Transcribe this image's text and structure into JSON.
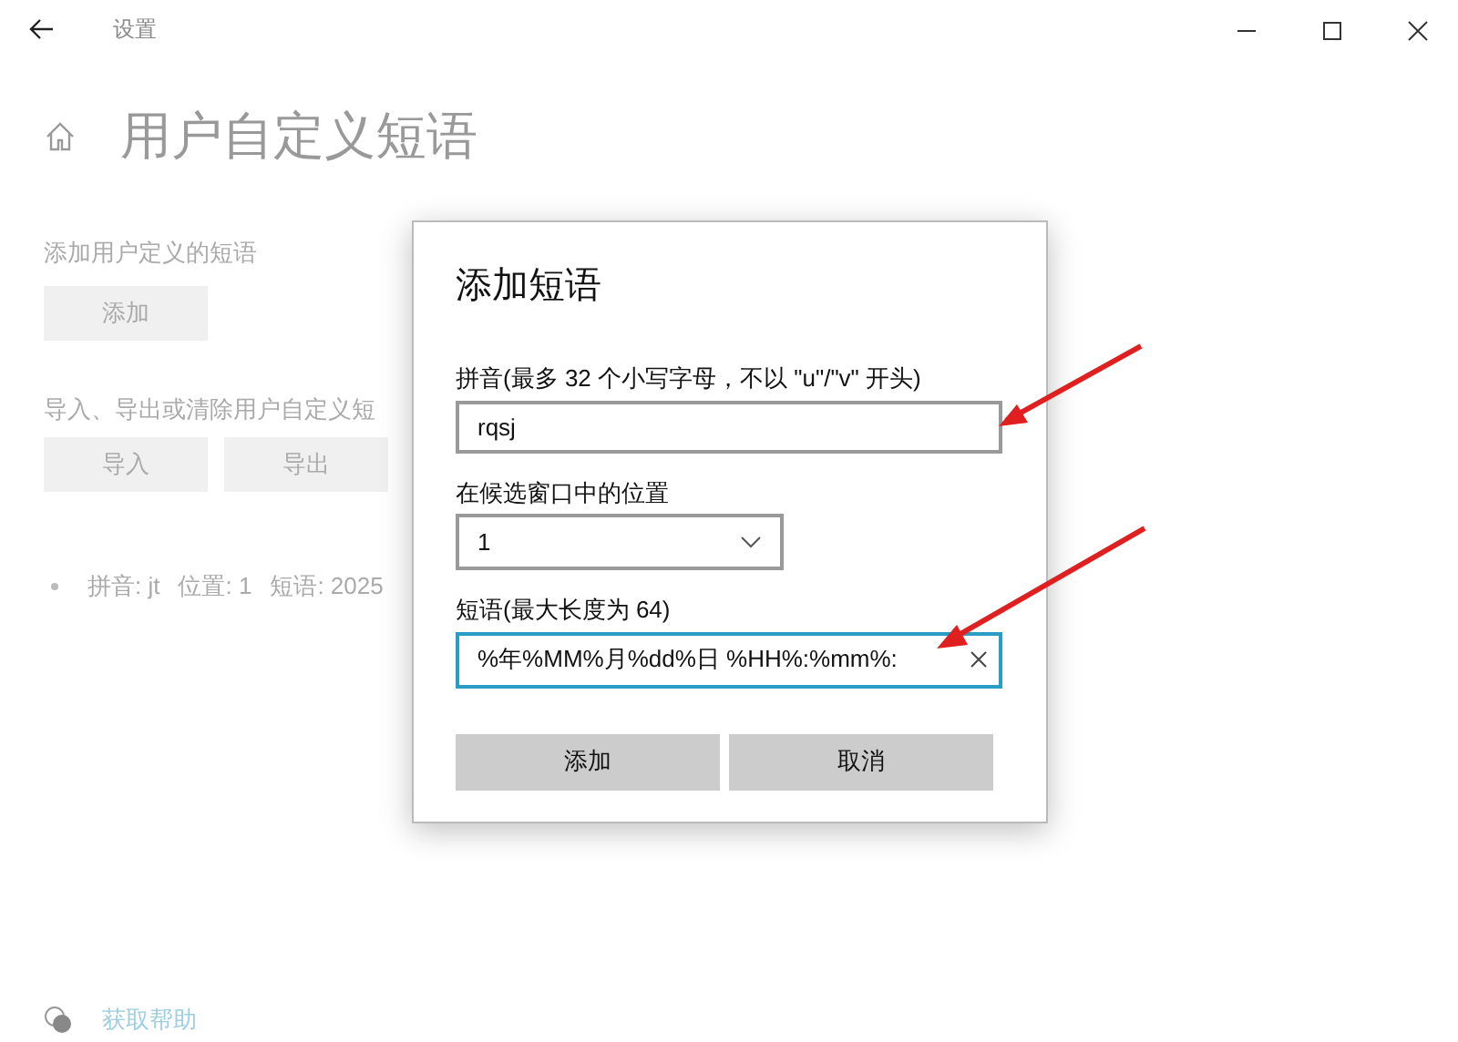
{
  "window": {
    "title": "设置"
  },
  "page": {
    "title": "用户自定义短语",
    "add_section": {
      "label": "添加用户定义的短语",
      "button": "添加"
    },
    "manage_section": {
      "label": "导入、导出或清除用户自定义短",
      "buttons": [
        "导入",
        "导出"
      ]
    },
    "phrases": [
      {
        "pinyin": "拼音: jt",
        "position": "位置: 1",
        "phrase": "短语: 2025"
      }
    ],
    "help_link": "获取帮助"
  },
  "dialog": {
    "title": "添加短语",
    "pinyin_label": "拼音(最多 32 个小写字母，不以 \"u\"/\"v\" 开头)",
    "pinyin_value": "rqsj",
    "position_label": "在候选窗口中的位置",
    "position_value": "1",
    "phrase_label": "短语(最大长度为 64)",
    "phrase_value": "%年%MM%月%dd%日 %HH%:%mm%:",
    "buttons": [
      "添加",
      "取消"
    ]
  }
}
